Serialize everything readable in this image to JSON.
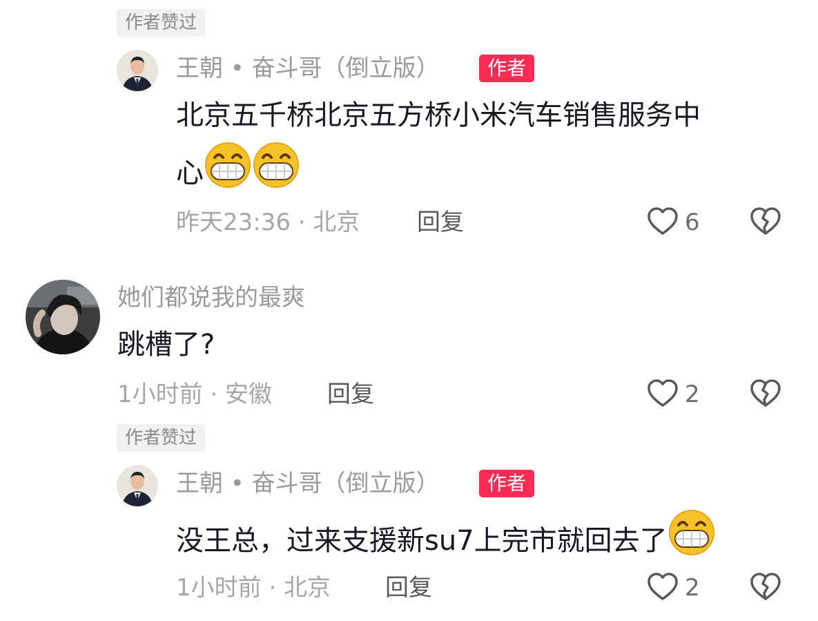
{
  "comments": [
    {
      "liked_tag": "作者赞过",
      "author": "王朝 • 奋斗哥（倒立版）",
      "badge": "作者",
      "text_line1": "北京五千桥北京五方桥小米汽车销售服务中",
      "text_line2": "心",
      "emoji_count": 2,
      "meta": "昨天23:36 · 北京",
      "reply": "回复",
      "likes": "6",
      "like_icon": "heart-outline-icon",
      "dislike_icon": "broken-heart-icon"
    },
    {
      "author": "她们都说我的最爽",
      "text": "跳槽了?",
      "meta": "1小时前 · 安徽",
      "reply": "回复",
      "likes": "2"
    },
    {
      "liked_tag": "作者赞过",
      "author": "王朝 • 奋斗哥（倒立版）",
      "badge": "作者",
      "text": "没王总，过来支援新su7上完市就回去了",
      "emoji_count": 1,
      "meta": "1小时前 · 北京",
      "reply": "回复",
      "likes": "2"
    }
  ],
  "colors": {
    "badge": "#fe2c55",
    "text": "#161823",
    "meta": "#a6a6aa",
    "emoji_face": "#f7c228"
  }
}
